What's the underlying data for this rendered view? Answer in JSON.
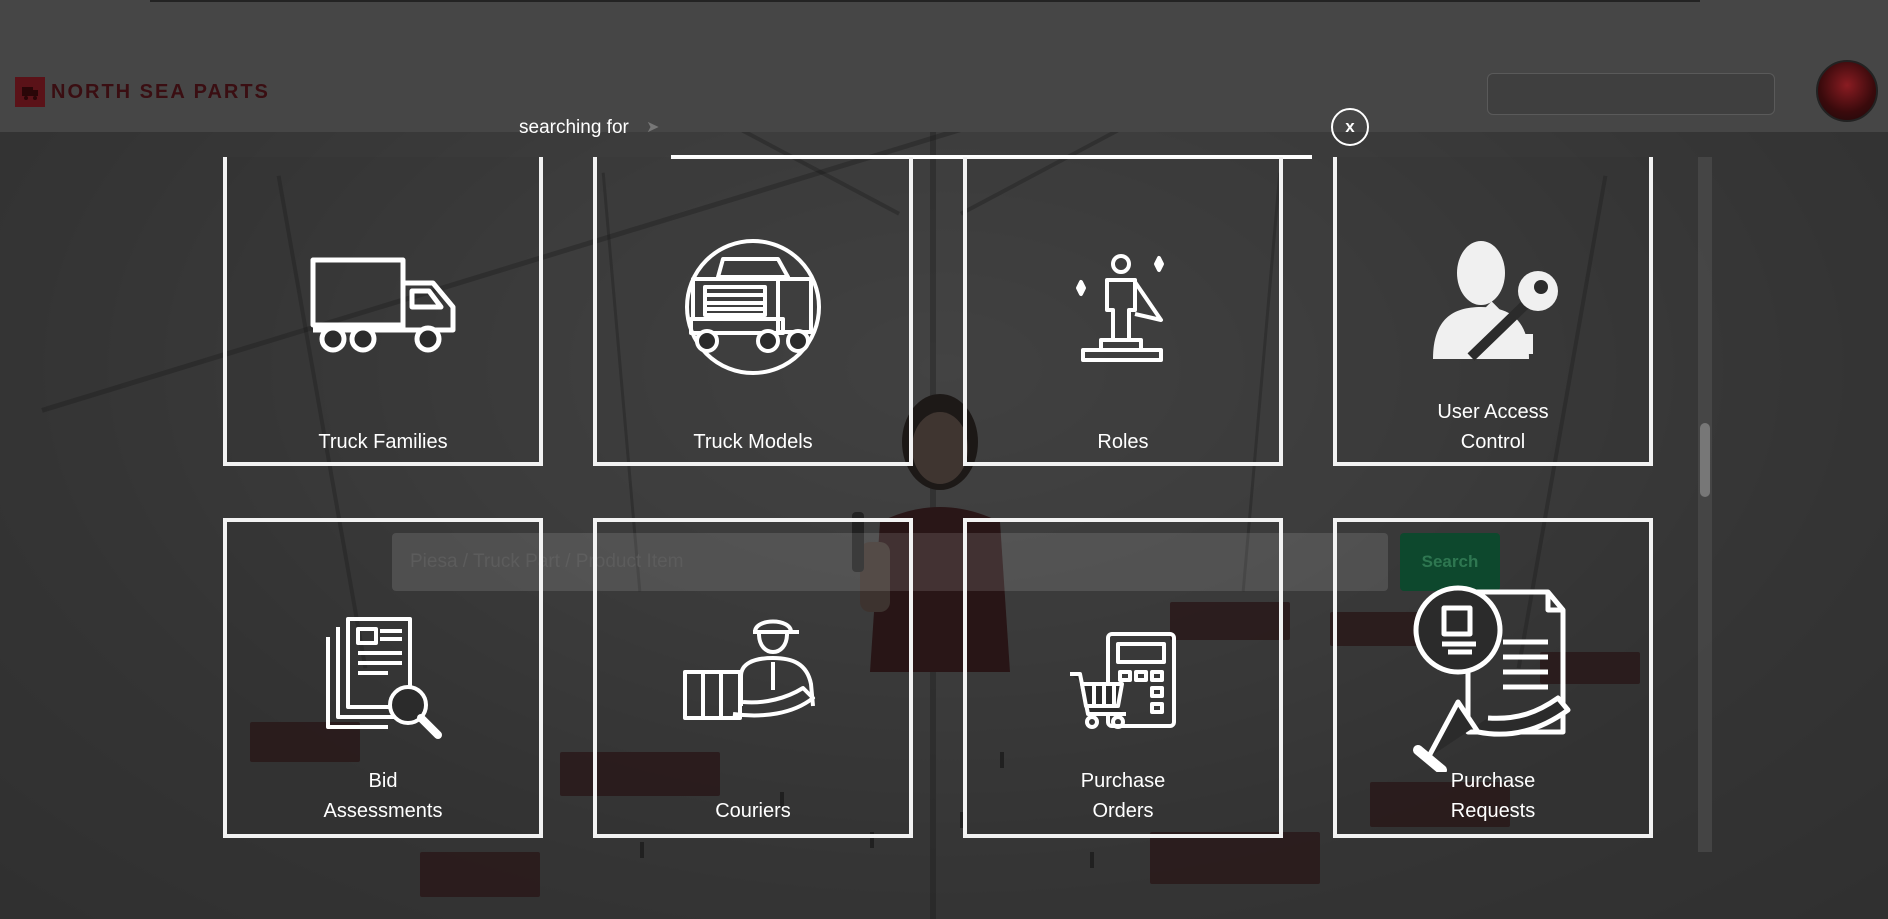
{
  "header": {
    "brand": "NORTH SEA PARTS"
  },
  "hero_search": {
    "placeholder": "Piesa / Truck Part / Product Item",
    "button_label": "Search"
  },
  "modal": {
    "searching_label": "searching for",
    "arrow": "➤",
    "close_label": "x",
    "cards": [
      {
        "label": "Truck Families",
        "icon": "truck-icon"
      },
      {
        "label": "Truck Models",
        "icon": "truck-front-icon"
      },
      {
        "label": "Roles",
        "icon": "hero-podium-icon"
      },
      {
        "label": "User Access Control",
        "line1": "User Access",
        "line2": "Control",
        "icon": "user-key-icon"
      },
      {
        "label": "Bid Assessments",
        "line1": "Bid",
        "line2": "Assessments",
        "icon": "document-search-icon"
      },
      {
        "label": "Couriers",
        "icon": "courier-icon"
      },
      {
        "label": "Purchase Orders",
        "line1": "Purchase",
        "line2": "Orders",
        "icon": "cart-calculator-icon"
      },
      {
        "label": "Purchase Requests",
        "line1": "Purchase",
        "line2": "Requests",
        "icon": "hand-document-icon"
      }
    ]
  },
  "colors": {
    "overlay": "#141414",
    "card_border": "#f2f2f2",
    "brand": "#5a1218",
    "search_button": "#0e4a2e"
  }
}
